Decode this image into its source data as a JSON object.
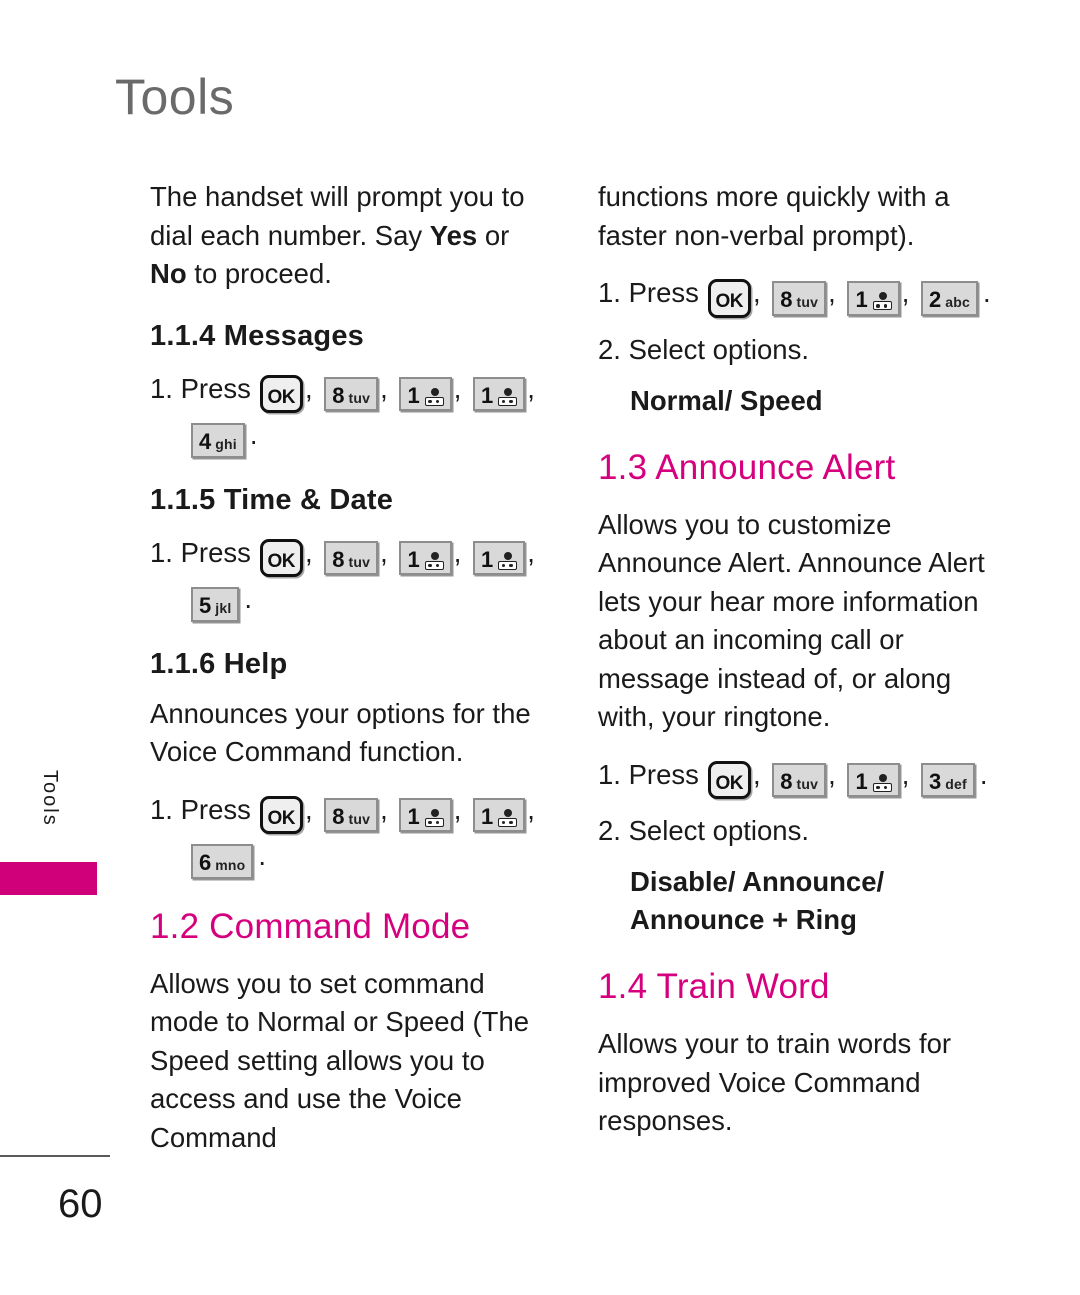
{
  "page": {
    "chapter_title": "Tools",
    "side_tab_label": "Tools",
    "page_number": "60"
  },
  "keys": {
    "ok": {
      "label": "OK"
    },
    "k1": {
      "digit": "1",
      "letters": "",
      "icon": "voicemail-icon"
    },
    "k2": {
      "digit": "2",
      "letters": "abc"
    },
    "k3": {
      "digit": "3",
      "letters": "def"
    },
    "k4": {
      "digit": "4",
      "letters": "ghi"
    },
    "k5": {
      "digit": "5",
      "letters": "jkl"
    },
    "k6": {
      "digit": "6",
      "letters": "mno"
    },
    "k8": {
      "digit": "8",
      "letters": "tuv"
    }
  },
  "left_column": {
    "intro_paragraph_plain": "The handset will prompt you to dial each number. Say Yes or No to proceed.",
    "intro_part1": "The handset will prompt you to dial each number. Say ",
    "intro_yes": "Yes",
    "intro_mid": " or ",
    "intro_no": "No",
    "intro_part2": " to proceed.",
    "section_messages": {
      "heading": "1.1.4 Messages",
      "step_number": "1.",
      "step_verb": "Press"
    },
    "section_time_date": {
      "heading": "1.1.5 Time & Date",
      "step_number": "1.",
      "step_verb": "Press"
    },
    "section_help": {
      "heading": "1.1.6 Help",
      "body": "Announces your options for the Voice Command function.",
      "step_number": "1.",
      "step_verb": "Press"
    },
    "section_command_mode": {
      "heading": "1.2 Command Mode",
      "body": "Allows you to set command mode to Normal or Speed (The Speed setting allows you to access and use the Voice Command"
    }
  },
  "right_column": {
    "continuation": "functions more quickly with a faster non-verbal prompt).",
    "command_mode_steps": {
      "step1_number": "1.",
      "step1_verb": "Press",
      "step2_number": "2.",
      "step2_text": "Select options.",
      "options": "Normal/ Speed"
    },
    "section_announce_alert": {
      "heading": "1.3 Announce Alert",
      "body": "Allows you to customize Announce Alert. Announce Alert lets your hear more information about an incoming call or message instead of, or along with, your ringtone.",
      "step1_number": "1.",
      "step1_verb": "Press",
      "step2_number": "2.",
      "step2_text": "Select options.",
      "options_line1": "Disable/ Announce/",
      "options_line2": "Announce + Ring"
    },
    "section_train_word": {
      "heading": "1.4 Train Word",
      "body": "Allows your to train words for improved Voice Command responses."
    }
  },
  "colors": {
    "accent_pink": "#d6007f",
    "tab_pink": "#d0007a",
    "header_gray": "#6a6a6a",
    "body_black": "#1a1a1a"
  },
  "punctuation": {
    "comma": ",",
    "period": "."
  }
}
